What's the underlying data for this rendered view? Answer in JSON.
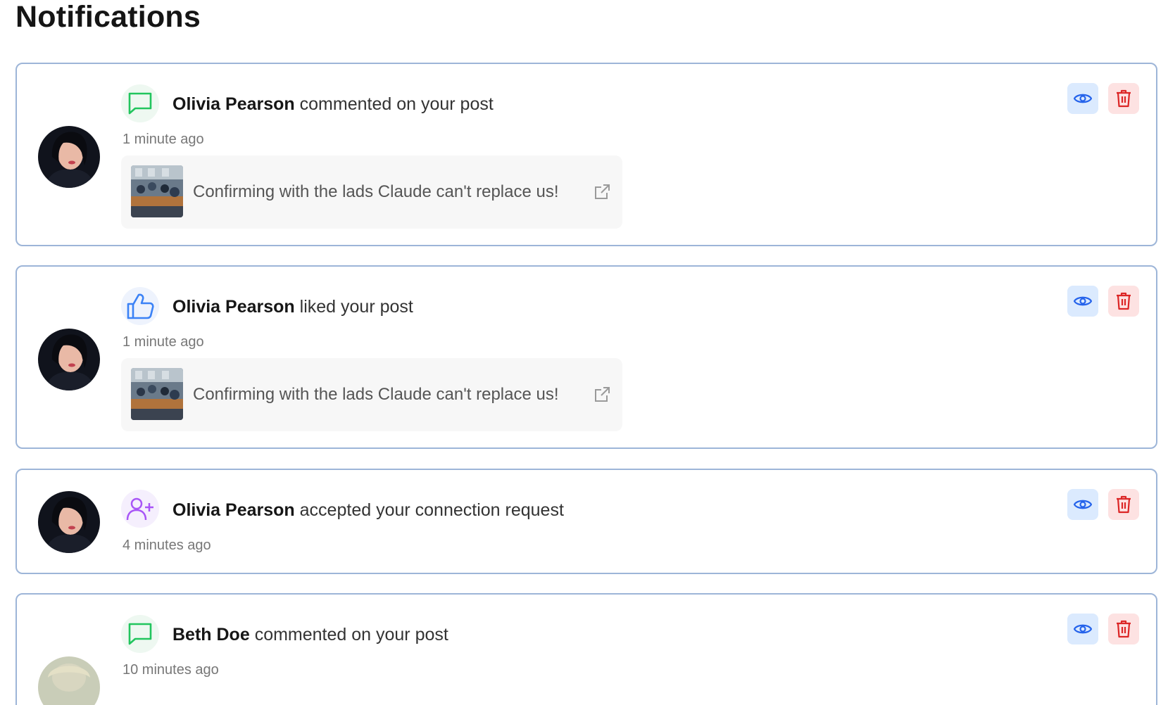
{
  "page": {
    "title": "Notifications"
  },
  "colors": {
    "card_border": "#9db5d8",
    "comment_icon": "#22c55e",
    "like_icon": "#3b82f6",
    "connection_icon": "#a855f7",
    "view_button_bg": "#dbeafe",
    "view_icon": "#2563eb",
    "delete_button_bg": "#fde2e2",
    "delete_icon": "#dc2626"
  },
  "notifications": [
    {
      "type_icon": "comment-icon",
      "actor": "Olivia Pearson",
      "action": "commented on your post",
      "time": "1 minute ago",
      "post_text": "Confirming with the lads Claude can't replace us!"
    },
    {
      "type_icon": "thumbs-up-icon",
      "actor": "Olivia Pearson",
      "action": "liked your post",
      "time": "1 minute ago",
      "post_text": "Confirming with the lads Claude can't replace us!"
    },
    {
      "type_icon": "user-plus-icon",
      "actor": "Olivia Pearson",
      "action": "accepted your connection request",
      "time": "4 minutes ago"
    },
    {
      "type_icon": "comment-icon",
      "actor": "Beth Doe",
      "action": "commented on your post",
      "time": "10 minutes ago"
    }
  ]
}
